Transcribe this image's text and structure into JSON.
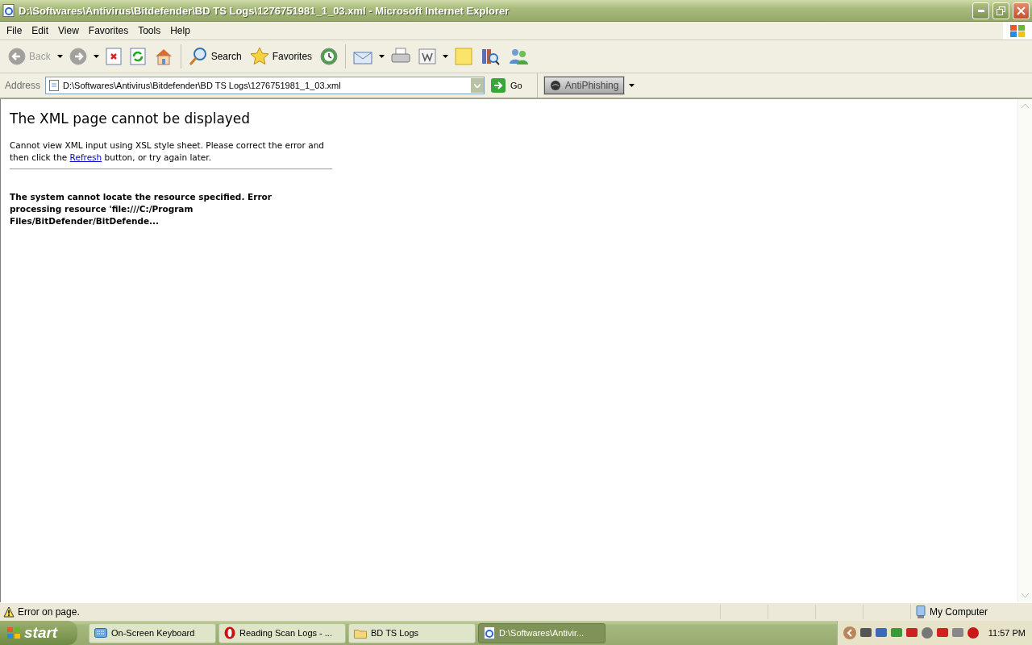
{
  "window": {
    "title": "D:\\Softwares\\Antivirus\\Bitdefender\\BD TS Logs\\1276751981_1_03.xml - Microsoft Internet Explorer"
  },
  "menu": [
    {
      "label": "File"
    },
    {
      "label": "Edit"
    },
    {
      "label": "View"
    },
    {
      "label": "Favorites"
    },
    {
      "label": "Tools"
    },
    {
      "label": "Help"
    }
  ],
  "toolbar": [
    {
      "kind": "back",
      "label": "Back",
      "disabled": true
    },
    {
      "kind": "forward",
      "disabled": true
    },
    {
      "kind": "stop",
      "disabled": false
    },
    {
      "kind": "refresh",
      "disabled": false
    },
    {
      "kind": "home",
      "disabled": false
    },
    {
      "kind": "search",
      "label": "Search",
      "disabled": false
    },
    {
      "kind": "favorites",
      "label": "Favorites",
      "disabled": false
    },
    {
      "kind": "history",
      "disabled": false
    },
    {
      "kind": "mail",
      "disabled": false
    },
    {
      "kind": "print",
      "disabled": false
    },
    {
      "kind": "edit",
      "disabled": false
    },
    {
      "kind": "note",
      "disabled": false
    },
    {
      "kind": "research",
      "disabled": false
    },
    {
      "kind": "messenger",
      "disabled": false
    }
  ],
  "address": {
    "label": "Address",
    "value": "D:\\Softwares\\Antivirus\\Bitdefender\\BD TS Logs\\1276751981_1_03.xml",
    "go": "Go"
  },
  "antiphishing": {
    "label": "AntiPhishing"
  },
  "page": {
    "heading": "The XML page cannot be displayed",
    "message": [
      "Cannot view XML input using XSL style sheet. Please correct the error and then click the ",
      "Refresh",
      " button, or try again later."
    ],
    "error": "The system cannot locate the resource specified. Error processing resource 'file:///C:/Program Files/BitDefender/BitDefende..."
  },
  "status_bar": {
    "text": "Error on page.",
    "zone": "My Computer"
  },
  "taskbar": {
    "start": "start",
    "tasks": [
      {
        "kind": "keyboard",
        "label": "On-Screen Keyboard",
        "selected": false
      },
      {
        "kind": "opera",
        "label": "Reading Scan Logs - ...",
        "selected": false
      },
      {
        "kind": "folder",
        "label": "BD TS Logs",
        "selected": false
      },
      {
        "kind": "ie",
        "label": "D:\\Softwares\\Antivir...",
        "selected": true
      }
    ],
    "clock": "11:57 PM"
  }
}
